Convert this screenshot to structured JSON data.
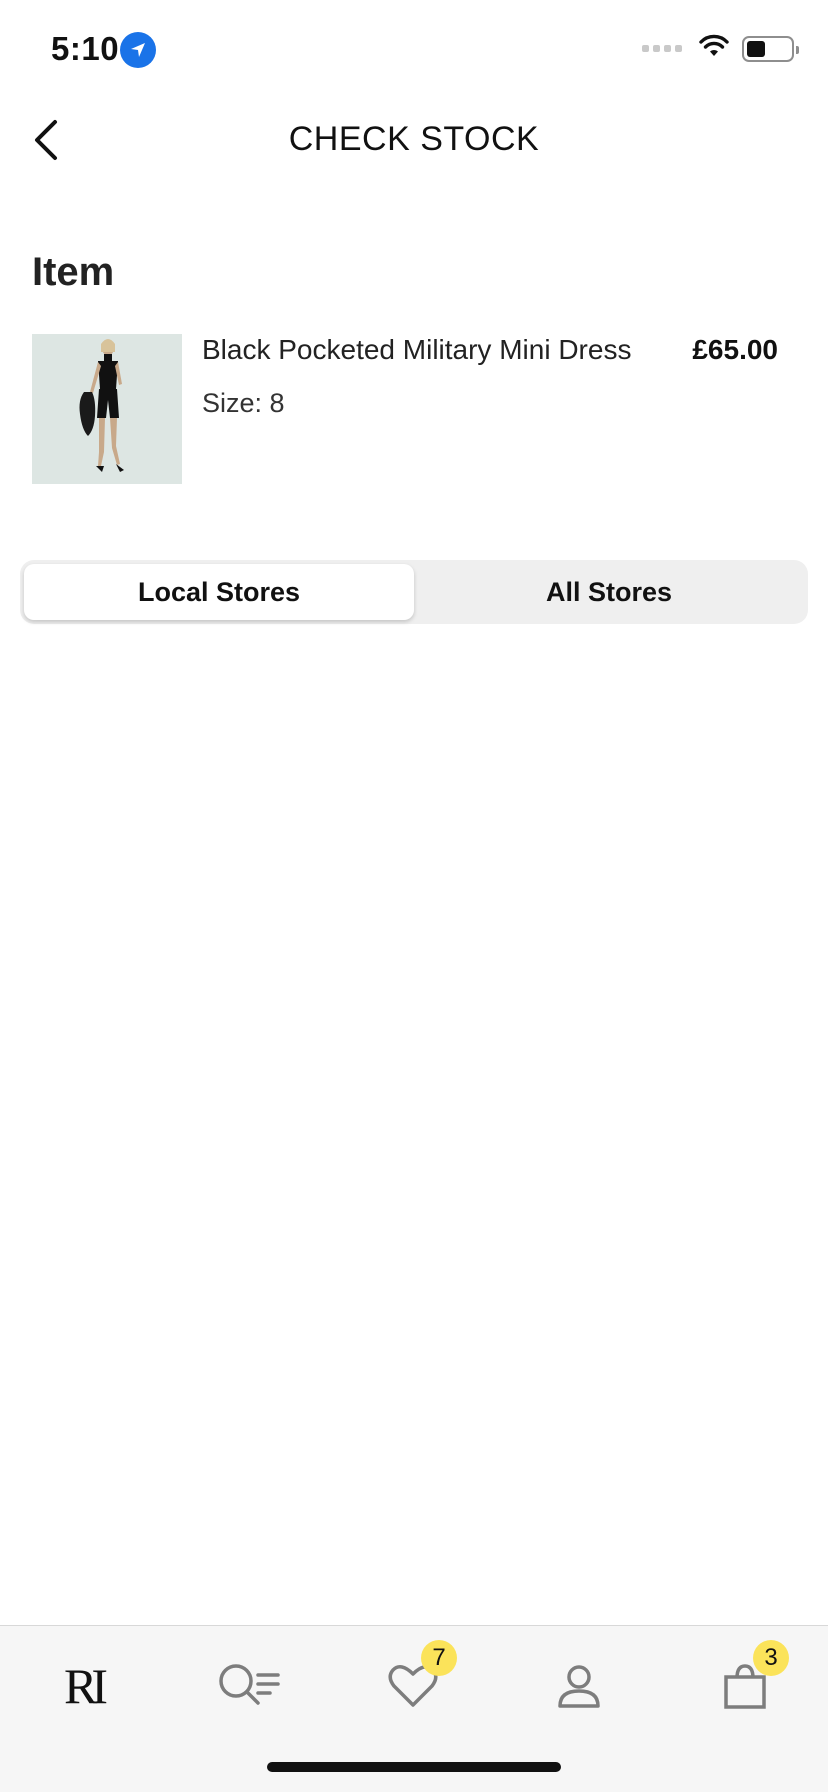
{
  "status_bar": {
    "time": "5:10"
  },
  "header": {
    "title": "CHECK STOCK"
  },
  "item_section": {
    "heading": "Item",
    "product": {
      "name": "Black Pocketed Military Mini Dress",
      "size_label": "Size:",
      "size_value": "8",
      "price": "£65.00"
    }
  },
  "store_toggle": {
    "segments": [
      {
        "label": "Local Stores",
        "selected": true
      },
      {
        "label": "All Stores",
        "selected": false
      }
    ]
  },
  "tab_bar": {
    "items": [
      {
        "name": "home",
        "icon": "brand-logo-icon",
        "logo_text": "RI"
      },
      {
        "name": "search",
        "icon": "search-filter-icon"
      },
      {
        "name": "wishlist",
        "icon": "heart-icon",
        "badge": "7"
      },
      {
        "name": "account",
        "icon": "person-icon"
      },
      {
        "name": "bag",
        "icon": "shopping-bag-icon",
        "badge": "3"
      }
    ]
  },
  "colors": {
    "accent_blue": "#1a73e8",
    "badge_yellow": "#fbe35a",
    "segment_bg": "#efefef",
    "tab_bar_bg": "#f6f6f6"
  }
}
